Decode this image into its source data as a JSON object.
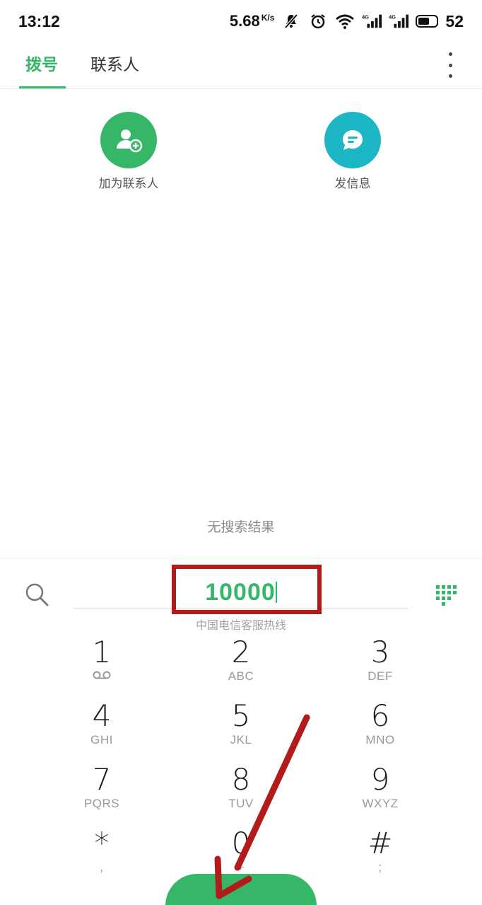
{
  "status_bar": {
    "time": "13:12",
    "speed": "5.68",
    "speed_unit": "K/s",
    "battery": "52"
  },
  "tabs": {
    "dial": "拨号",
    "contacts": "联系人"
  },
  "actions": {
    "add_contact": "加为联系人",
    "send_message": "发信息"
  },
  "no_results": "无搜索结果",
  "dialer": {
    "number": "10000",
    "description": "中国电信客服热线"
  },
  "keys": [
    {
      "digit": "1",
      "letters": ""
    },
    {
      "digit": "2",
      "letters": "ABC"
    },
    {
      "digit": "3",
      "letters": "DEF"
    },
    {
      "digit": "4",
      "letters": "GHI"
    },
    {
      "digit": "5",
      "letters": "JKL"
    },
    {
      "digit": "6",
      "letters": "MNO"
    },
    {
      "digit": "7",
      "letters": "PQRS"
    },
    {
      "digit": "8",
      "letters": "TUV"
    },
    {
      "digit": "9",
      "letters": "WXYZ"
    },
    {
      "digit": "*",
      "letters": ","
    },
    {
      "digit": "0",
      "letters": "+"
    },
    {
      "digit": "#",
      "letters": ";"
    }
  ],
  "colors": {
    "accent": "#36b768",
    "teal": "#1cb6c4",
    "annotation": "#b31b1b"
  },
  "icons": {
    "add_contact": "person-add-icon",
    "message": "message-icon",
    "search": "search-icon",
    "keypad": "keypad-icon",
    "voicemail": "voicemail-icon",
    "menu": "more-vertical-icon"
  }
}
